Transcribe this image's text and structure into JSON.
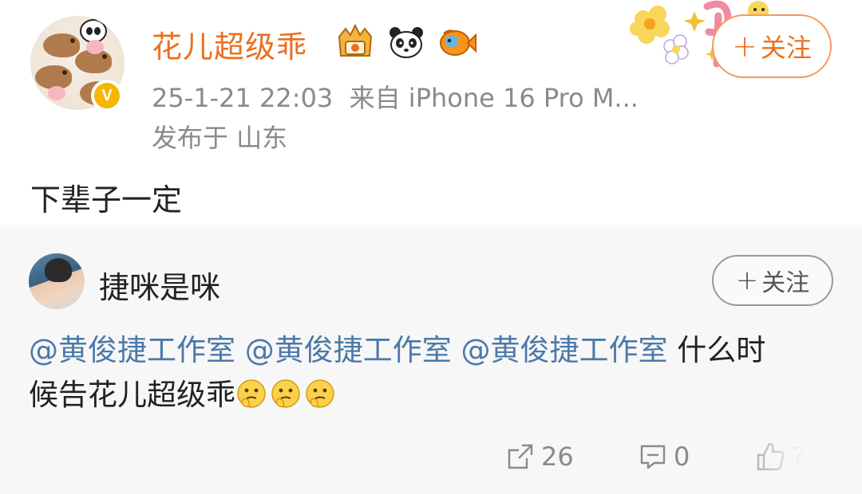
{
  "post": {
    "username": "花儿超级乖",
    "badges": [
      "crown-badge-icon",
      "panda-badge-icon",
      "fish-badge-icon"
    ],
    "verified_mark": "V",
    "meta_line": "25-1-21 22:03  来自 iPhone 16 Pro M...",
    "location": "发布于 山东",
    "text": "下辈子一定",
    "follow_label": "关注",
    "follow_plus": "+"
  },
  "repost": {
    "username": "捷咪是咪",
    "follow_label": "关注",
    "follow_plus": "+",
    "mentions": [
      "@黄俊捷工作室",
      "@黄俊捷工作室",
      "@黄俊捷工作室"
    ],
    "text_line1_tail": " 什么时",
    "text_line2": "候告花儿超级乖",
    "emoji_icons": [
      "thinking-face-icon",
      "thinking-face-icon",
      "thinking-face-icon"
    ]
  },
  "actions": {
    "share_count": "26",
    "comment_count": "0",
    "like_count": "?"
  },
  "colors": {
    "accent_orange": "#ec6f1f",
    "mention_blue": "#4b79a8",
    "muted_gray": "#8a8a8a",
    "card_bg": "#f7f7f7"
  }
}
